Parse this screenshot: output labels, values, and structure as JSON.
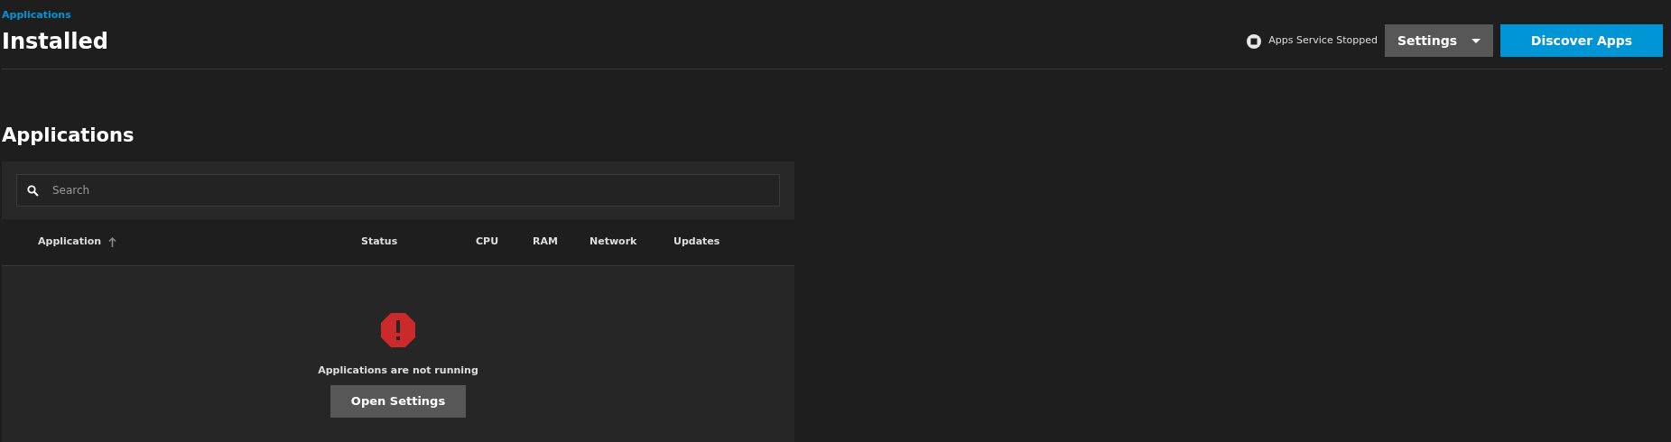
{
  "breadcrumb": "Applications",
  "title": "Installed",
  "service_status": {
    "text": "Apps Service Stopped",
    "running": false
  },
  "settings_button": {
    "label": "Settings"
  },
  "discover_button": {
    "label": "Discover Apps"
  },
  "section_title": "Applications",
  "search": {
    "placeholder": "Search"
  },
  "table": {
    "columns": [
      {
        "label": "Application",
        "sorted": true
      },
      {
        "label": "Status",
        "sorted": false
      },
      {
        "label": "CPU",
        "sorted": false
      },
      {
        "label": "RAM",
        "sorted": false
      },
      {
        "label": "Network",
        "sorted": false
      },
      {
        "label": "Updates",
        "sorted": false
      }
    ]
  },
  "empty_state": {
    "message": "Applications are not running",
    "button": "Open Settings"
  }
}
